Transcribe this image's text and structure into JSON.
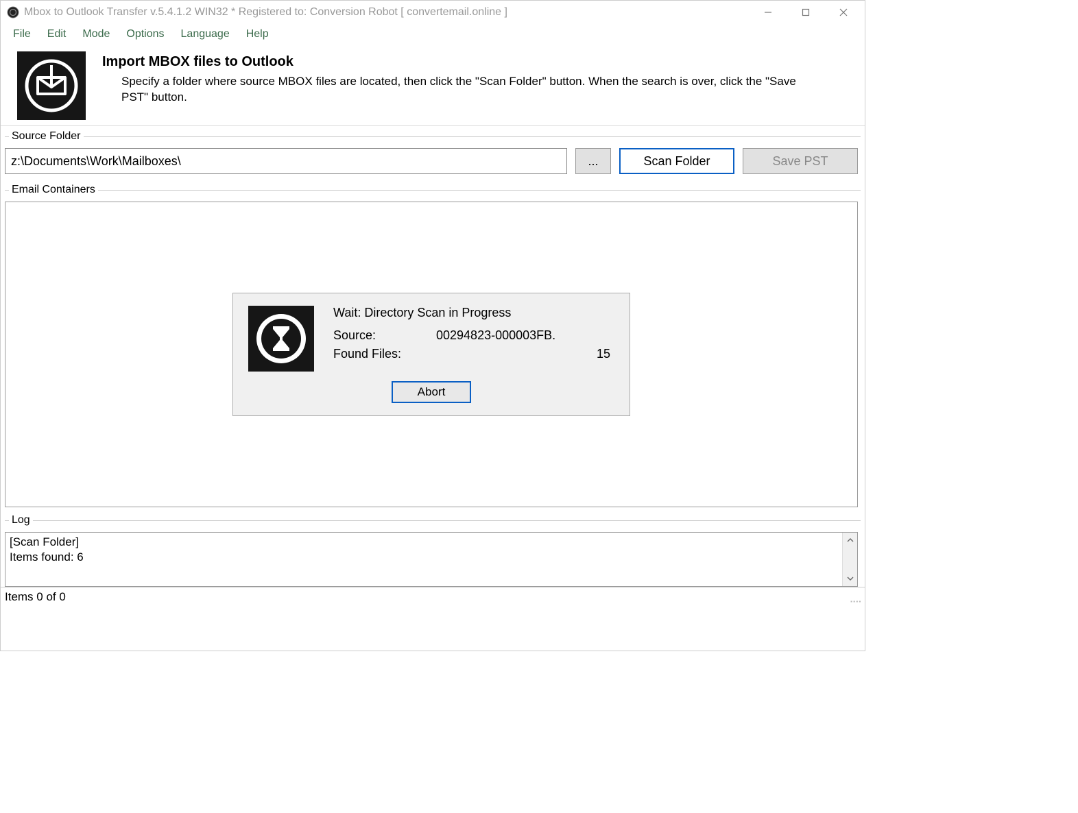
{
  "window": {
    "title": "Mbox to Outlook Transfer v.5.4.1.2 WIN32 * Registered to: Conversion Robot [ convertemail.online ]"
  },
  "menu": {
    "file": "File",
    "edit": "Edit",
    "mode": "Mode",
    "options": "Options",
    "language": "Language",
    "help": "Help"
  },
  "header": {
    "title": "Import MBOX files to Outlook",
    "description": "Specify a folder where source MBOX files are located, then click the \"Scan Folder\" button. When the search is over, click the \"Save PST\" button."
  },
  "source": {
    "legend": "Source Folder",
    "path": "z:\\Documents\\Work\\Mailboxes\\",
    "browse": "...",
    "scan": "Scan Folder",
    "savepst": "Save PST"
  },
  "containers": {
    "legend": "Email Containers"
  },
  "progress": {
    "title": "Wait: Directory Scan in Progress",
    "source_label": "Source:",
    "source_value": "00294823-000003FB.",
    "found_label": "Found Files:",
    "found_value": "15",
    "abort": "Abort"
  },
  "log": {
    "legend": "Log",
    "text": "[Scan Folder]\nItems found: 6"
  },
  "status": {
    "text": "Items 0 of 0"
  }
}
